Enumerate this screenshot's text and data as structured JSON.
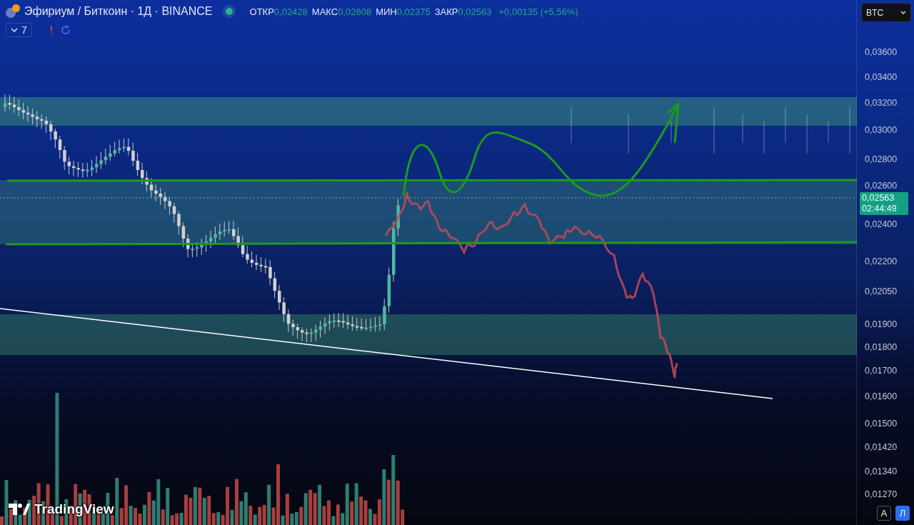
{
  "header": {
    "symbol": "Эфириум / Биткоин · 1Д · BINANCE",
    "market_open": true,
    "ohlc": [
      {
        "label": "ОТКР",
        "value": "0,02428"
      },
      {
        "label": "МАКС",
        "value": "0,02608"
      },
      {
        "label": "МИН",
        "value": "0,02375"
      },
      {
        "label": "ЗАКР",
        "value": "0,02563"
      }
    ],
    "change": "+0,00135 (+5,56%)"
  },
  "indicators": {
    "count": "7",
    "expanded": false
  },
  "currency": {
    "value": "BTC"
  },
  "price_axis": {
    "ticks": [
      "0,03600",
      "0,03400",
      "0,03200",
      "0,03000",
      "0,02800",
      "0,02600",
      "0,02400",
      "0,02200",
      "0,02050",
      "0,01900",
      "0,01800",
      "0,01700",
      "0,01600",
      "0,01500",
      "0,01420",
      "0,01340",
      "0,01270"
    ],
    "last_price": "0,02563",
    "countdown": "02:44:49"
  },
  "scale_buttons": [
    {
      "label": "A",
      "selected": false
    },
    {
      "label": "Л",
      "selected": true
    }
  ],
  "branding": "TradingView"
}
